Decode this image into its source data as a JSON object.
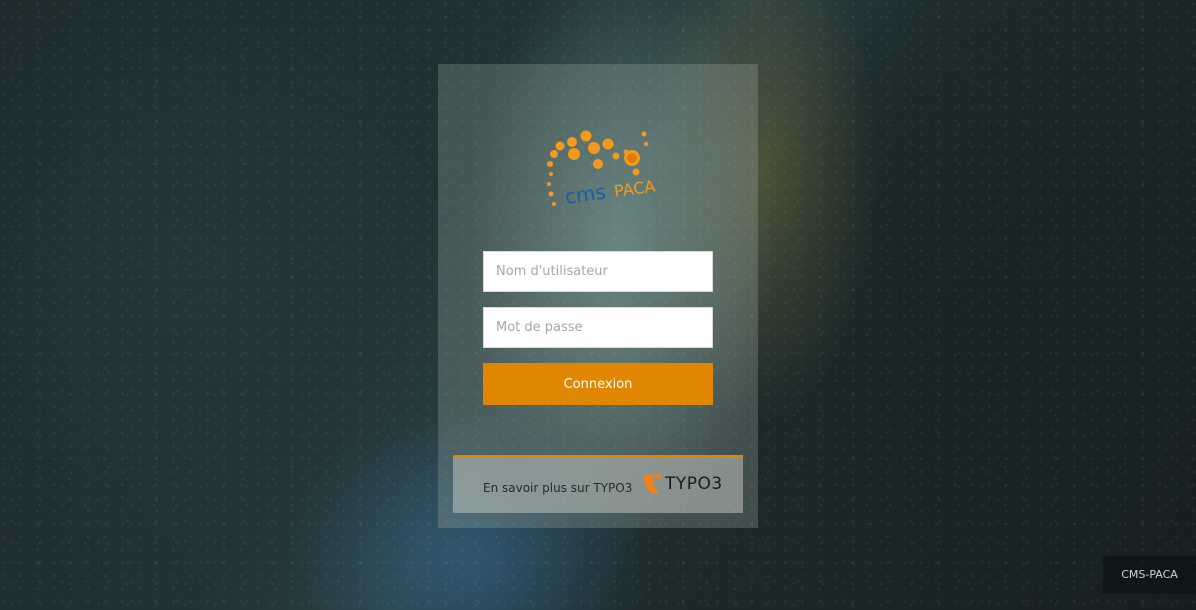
{
  "login": {
    "username_placeholder": "Nom d'utilisateur",
    "password_placeholder": "Mot de passe",
    "submit_label": "Connexion"
  },
  "footer": {
    "link_text": "En savoir plus sur TYPO3",
    "typo3_logo_text": "TYPO3"
  },
  "site_badge": "CMS-PACA",
  "logo": {
    "text": "cms PACA",
    "icon": "cms-paca-logo"
  },
  "colors": {
    "accent": "#e08600",
    "logo_orange": "#f39a1e",
    "logo_blue": "#1c5fa3"
  }
}
